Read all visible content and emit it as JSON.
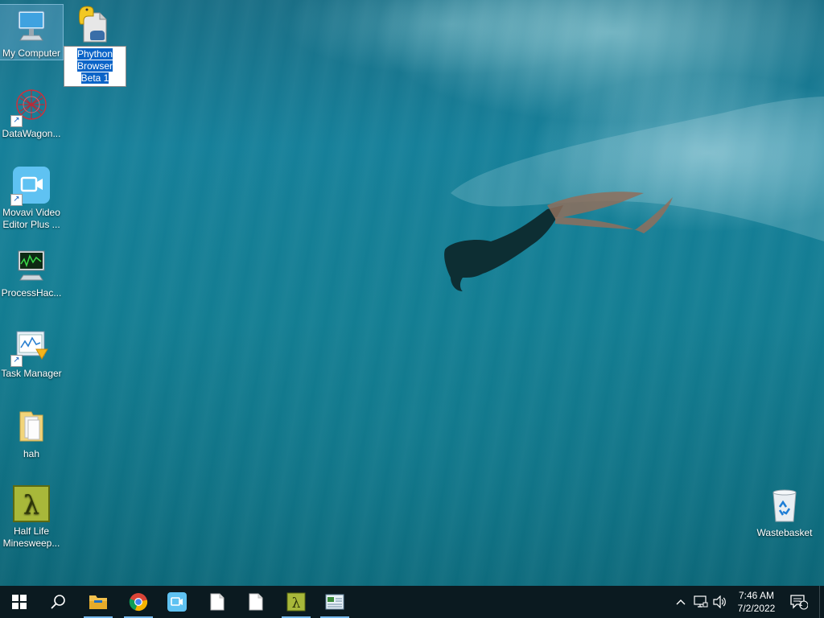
{
  "desktop": {
    "icons_left": [
      {
        "label": "My Computer",
        "icon": "monitor-icon"
      },
      {
        "label": "DataWagon...",
        "icon": "network-graph-icon"
      },
      {
        "label": "Movavi Video Editor Plus ...",
        "icon": "video-camera-icon"
      },
      {
        "label": "ProcessHac...",
        "icon": "process-monitor-icon"
      },
      {
        "label": "Task Manager",
        "icon": "task-manager-icon"
      },
      {
        "label": "hah",
        "icon": "folder-icon"
      },
      {
        "label": "Half Life Minesweep...",
        "icon": "lambda-icon"
      }
    ],
    "renaming_icon": {
      "label": "Phython Browser Beta 1",
      "icon": "python-file-icon"
    },
    "recycle_bin": {
      "label": "Wastebasket",
      "icon": "recycle-bin-icon"
    }
  },
  "taskbar": {
    "start": "windows-start-icon",
    "search": "search-icon",
    "pinned": [
      {
        "name": "file-explorer",
        "icon": "folder-icon",
        "running": true
      },
      {
        "name": "chrome",
        "icon": "chrome-icon",
        "running": true
      },
      {
        "name": "movavi",
        "icon": "video-camera-icon",
        "running": false
      },
      {
        "name": "document-1",
        "icon": "document-icon",
        "running": false
      },
      {
        "name": "document-2",
        "icon": "document-icon",
        "running": false
      },
      {
        "name": "half-life",
        "icon": "lambda-icon",
        "running": true
      },
      {
        "name": "task-manager",
        "icon": "task-manager-icon",
        "running": true
      }
    ],
    "clock": {
      "time": "7:46 AM",
      "date": "7/2/2022"
    },
    "notification_count": "1"
  },
  "colors": {
    "taskbar": "#0b1a20",
    "selection": "#0a64c8",
    "accent": "#76b9ed"
  }
}
